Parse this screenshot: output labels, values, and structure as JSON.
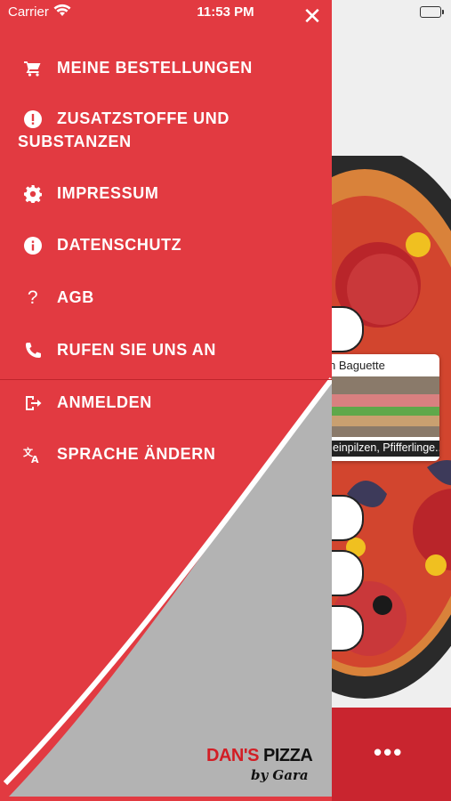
{
  "status_bar": {
    "carrier": "Carrier",
    "time": "11:53 PM"
  },
  "menu": {
    "items": [
      {
        "label": "MEINE BESTELLUNGEN",
        "icon": "cart-icon"
      },
      {
        "label": "ZUSATZSTOFFE UND",
        "label2": "SUBSTANZEN",
        "icon": "alert-icon"
      },
      {
        "label": "IMPRESSUM",
        "icon": "gear-icon"
      },
      {
        "label": "DATENSCHUTZ",
        "icon": "info-icon"
      },
      {
        "label": "AGB",
        "icon": "question-icon"
      },
      {
        "label": "RUFEN SIE UNS AN",
        "icon": "phone-icon"
      },
      {
        "label": "ANMELDEN",
        "icon": "login-icon"
      },
      {
        "label": "SPRACHE ÄNDERN",
        "icon": "translate-icon"
      }
    ]
  },
  "background": {
    "card_title": "n Baguette",
    "card_subtitle": "einpilzen, Pfifferlinge..."
  },
  "logo": {
    "part1": "DAN'S",
    "part2": "PIZZA",
    "tagline": "by Gara"
  },
  "colors": {
    "drawer": "#e23a41",
    "tabbar": "#c9252f",
    "curve": "#b3b3b3"
  }
}
